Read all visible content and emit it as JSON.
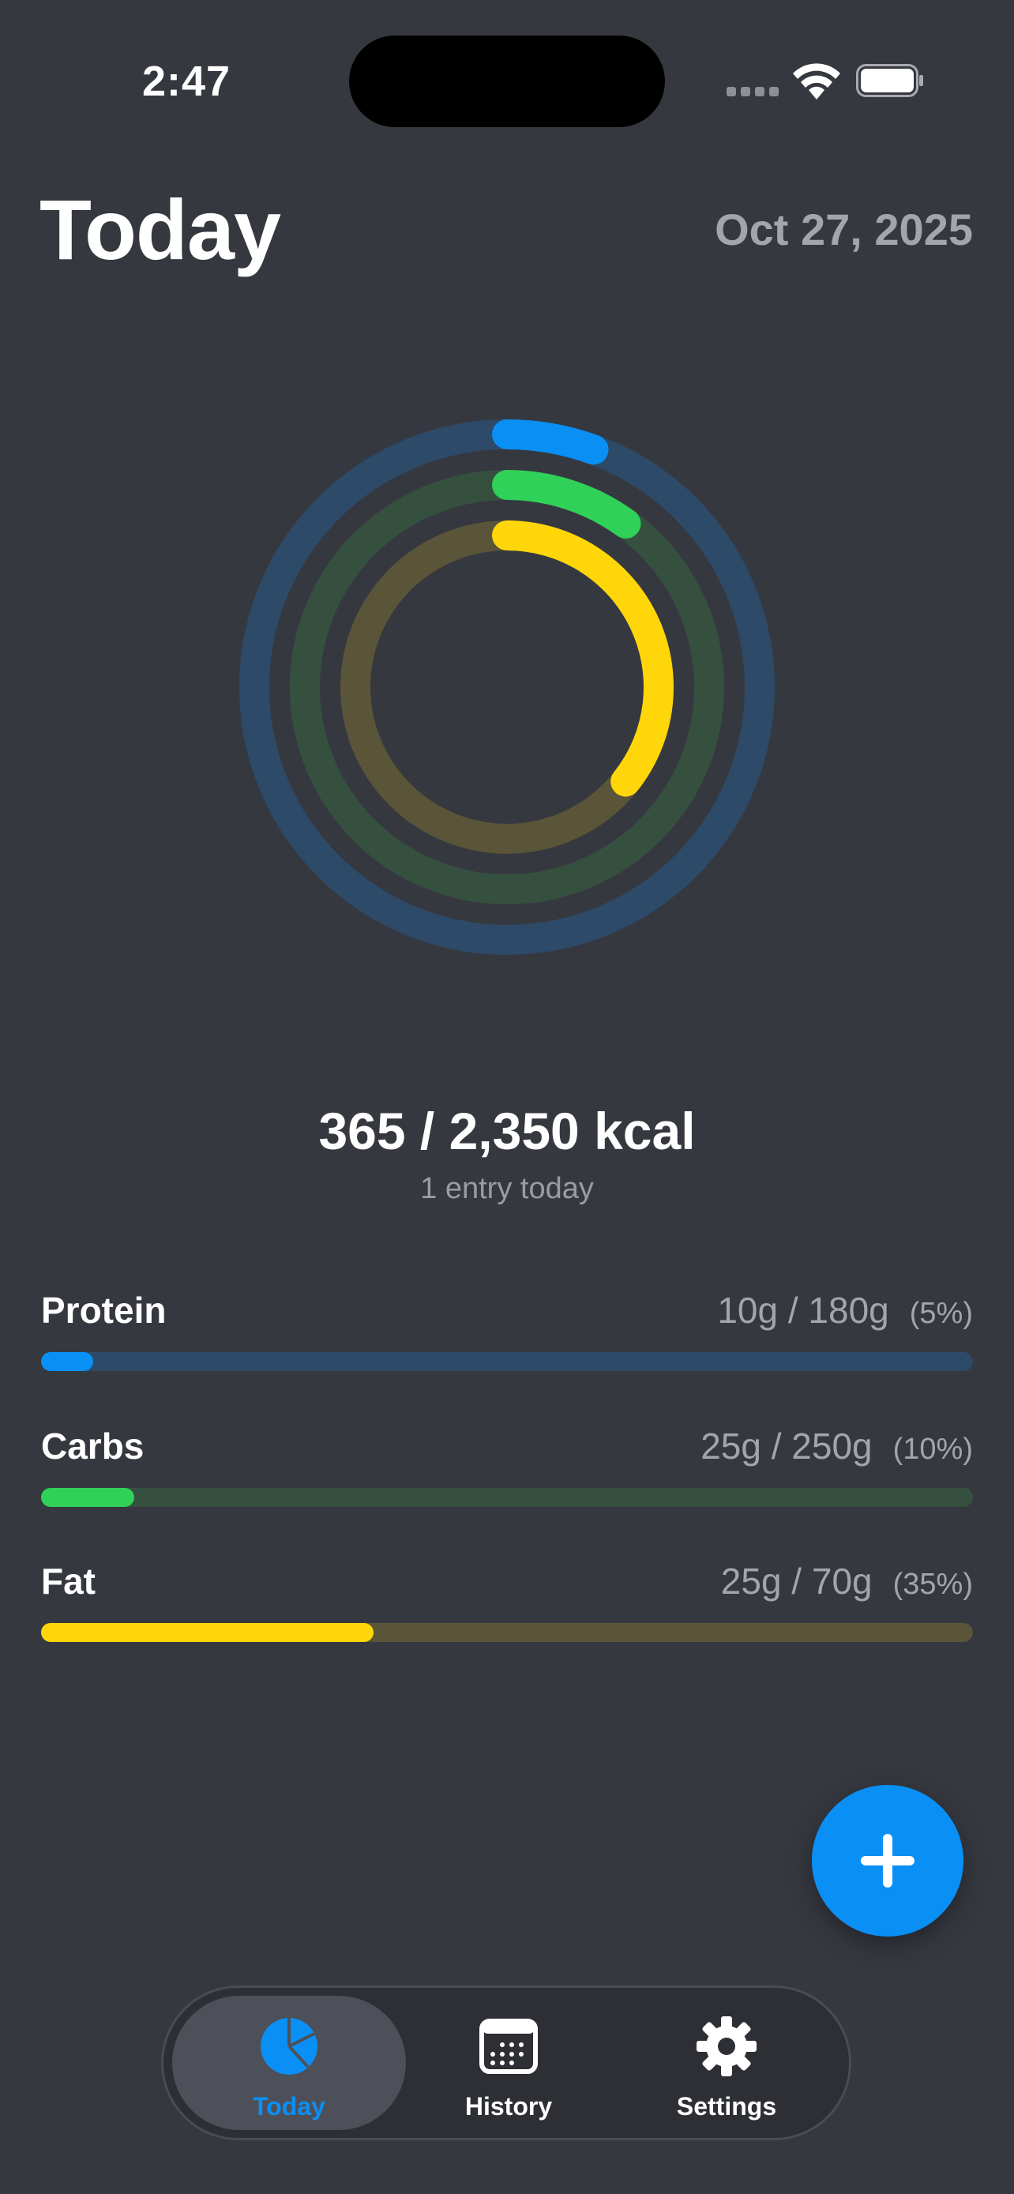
{
  "status_bar": {
    "time": "2:47"
  },
  "header": {
    "title": "Today",
    "date": "Oct 27, 2025"
  },
  "summary": {
    "calories": "365 / 2,350 kcal",
    "entries": "1 entry today"
  },
  "rings": [
    {
      "name": "Protein",
      "fraction": 0.0556,
      "color": "#0a8ff5",
      "track": "#2d4a68"
    },
    {
      "name": "Carbs",
      "fraction": 0.1,
      "color": "#30d158",
      "track": "#35503f"
    },
    {
      "name": "Fat",
      "fraction": 0.357,
      "color": "#ffd60a",
      "track": "#5a5538"
    }
  ],
  "macros": [
    {
      "label": "Protein",
      "amount": "10g / 180g",
      "percent": "(5%)",
      "fraction": 0.0556,
      "color": "#0a8ff5",
      "track": "#2d4a68"
    },
    {
      "label": "Carbs",
      "amount": "25g / 250g",
      "percent": "(10%)",
      "fraction": 0.1,
      "color": "#30d158",
      "track": "#35503f"
    },
    {
      "label": "Fat",
      "amount": "25g / 70g",
      "percent": "(35%)",
      "fraction": 0.357,
      "color": "#ffd60a",
      "track": "#5a5538"
    }
  ],
  "add_button": {
    "icon": "plus-icon"
  },
  "tabs": [
    {
      "label": "Today",
      "icon": "pie-chart-icon",
      "active": true
    },
    {
      "label": "History",
      "icon": "calendar-icon",
      "active": false
    },
    {
      "label": "Settings",
      "icon": "gear-icon",
      "active": false
    }
  ],
  "colors": {
    "background": "#363840",
    "accent": "#0a8ff5"
  }
}
